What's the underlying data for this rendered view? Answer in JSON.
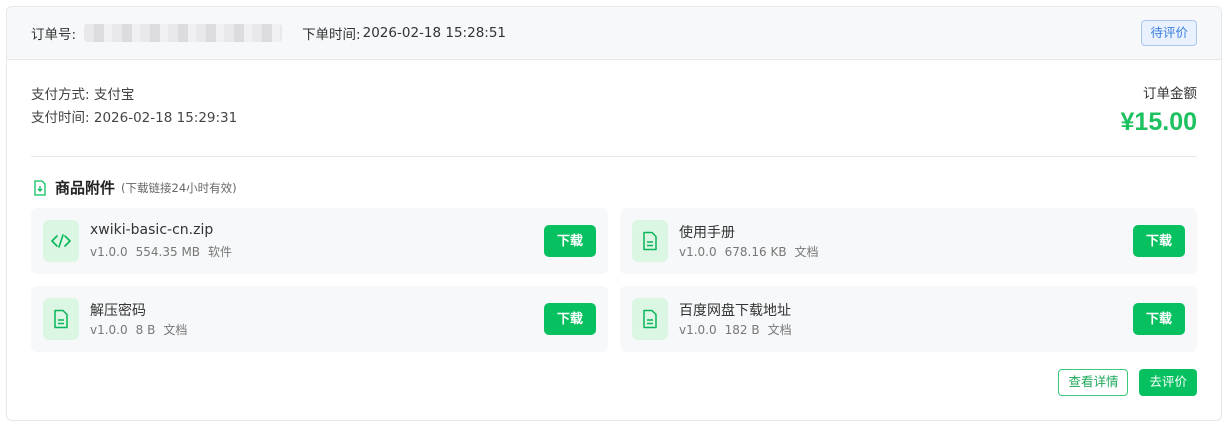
{
  "header": {
    "order_no_label": "订单号:",
    "order_time_label": "下单时间:",
    "order_time": "2026-02-18 15:28:51",
    "status": "待评价"
  },
  "payment": {
    "method_label": "支付方式:",
    "method": "支付宝",
    "time_label": "支付时间:",
    "time": "2026-02-18 15:29:31"
  },
  "amount": {
    "label": "订单金额",
    "value": "¥15.00"
  },
  "attachments_section": {
    "title": "商品附件",
    "note": "(下载链接24小时有效)",
    "items": [
      {
        "name": "xwiki-basic-cn.zip",
        "version": "v1.0.0",
        "size": "554.35 MB",
        "type": "软件",
        "icon": "code-icon",
        "button": "下载"
      },
      {
        "name": "使用手册",
        "version": "v1.0.0",
        "size": "678.16 KB",
        "type": "文档",
        "icon": "document-icon",
        "button": "下载"
      },
      {
        "name": "解压密码",
        "version": "v1.0.0",
        "size": "8 B",
        "type": "文档",
        "icon": "document-icon",
        "button": "下载"
      },
      {
        "name": "百度网盘下载地址",
        "version": "v1.0.0",
        "size": "182 B",
        "type": "文档",
        "icon": "document-icon",
        "button": "下载"
      }
    ]
  },
  "actions": {
    "view_detail": "查看详情",
    "review": "去评价"
  },
  "colors": {
    "accent_green": "#07c160",
    "amount_green": "#1ec15f",
    "status_blue": "#3a7fe0"
  }
}
